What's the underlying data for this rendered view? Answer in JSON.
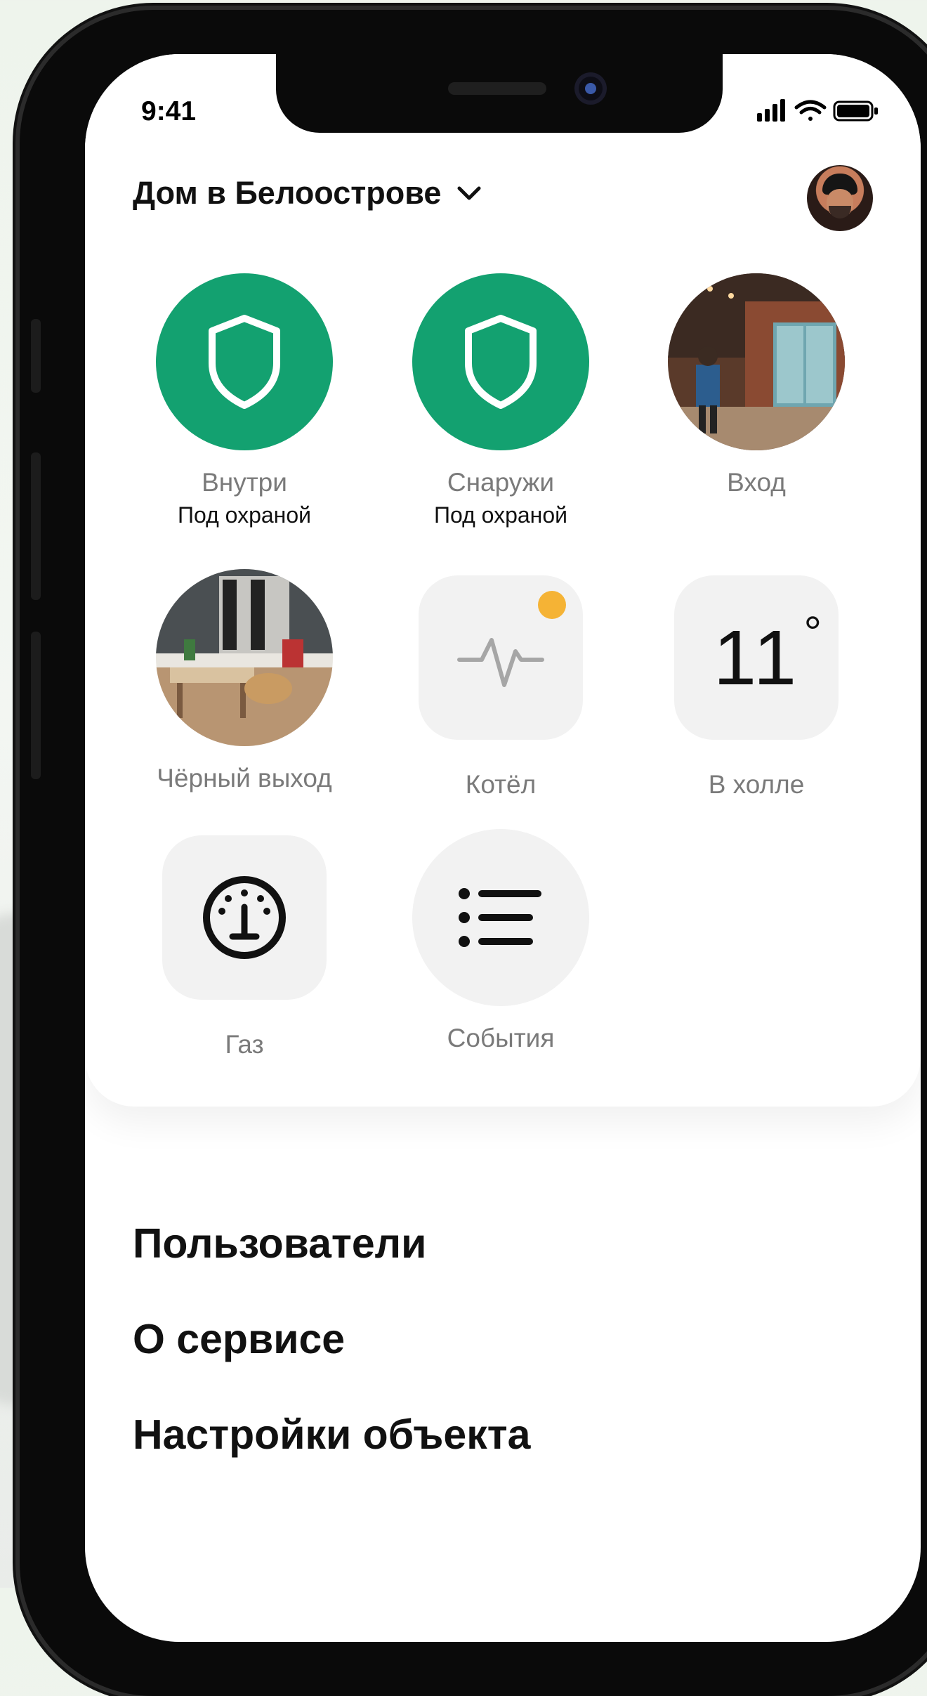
{
  "status_bar": {
    "time": "9:41"
  },
  "header": {
    "title": "Дом в Белоострове"
  },
  "tiles": [
    {
      "label": "Внутри",
      "status": "Под охраной"
    },
    {
      "label": "Снаружи",
      "status": "Под охраной"
    },
    {
      "label": "Вход"
    },
    {
      "label": "Чёрный выход"
    },
    {
      "label": "Котёл"
    },
    {
      "label": "В холле",
      "value": "11",
      "unit": "°"
    },
    {
      "label": "Газ"
    },
    {
      "label": "События"
    }
  ],
  "menu": {
    "items": [
      {
        "label": "Пользователи"
      },
      {
        "label": "О сервисе"
      },
      {
        "label": "Настройки объекта"
      }
    ]
  },
  "colors": {
    "accent_green": "#13a170",
    "tile_gray": "#f2f2f2",
    "badge_orange": "#f5b335",
    "text_primary": "#111111",
    "text_secondary": "#7a7a7a"
  },
  "icons": {
    "shield": "shield-icon",
    "pulse": "pulse-icon",
    "gauge": "gauge-icon",
    "list": "list-icon",
    "chevron": "chevron-down-icon"
  }
}
